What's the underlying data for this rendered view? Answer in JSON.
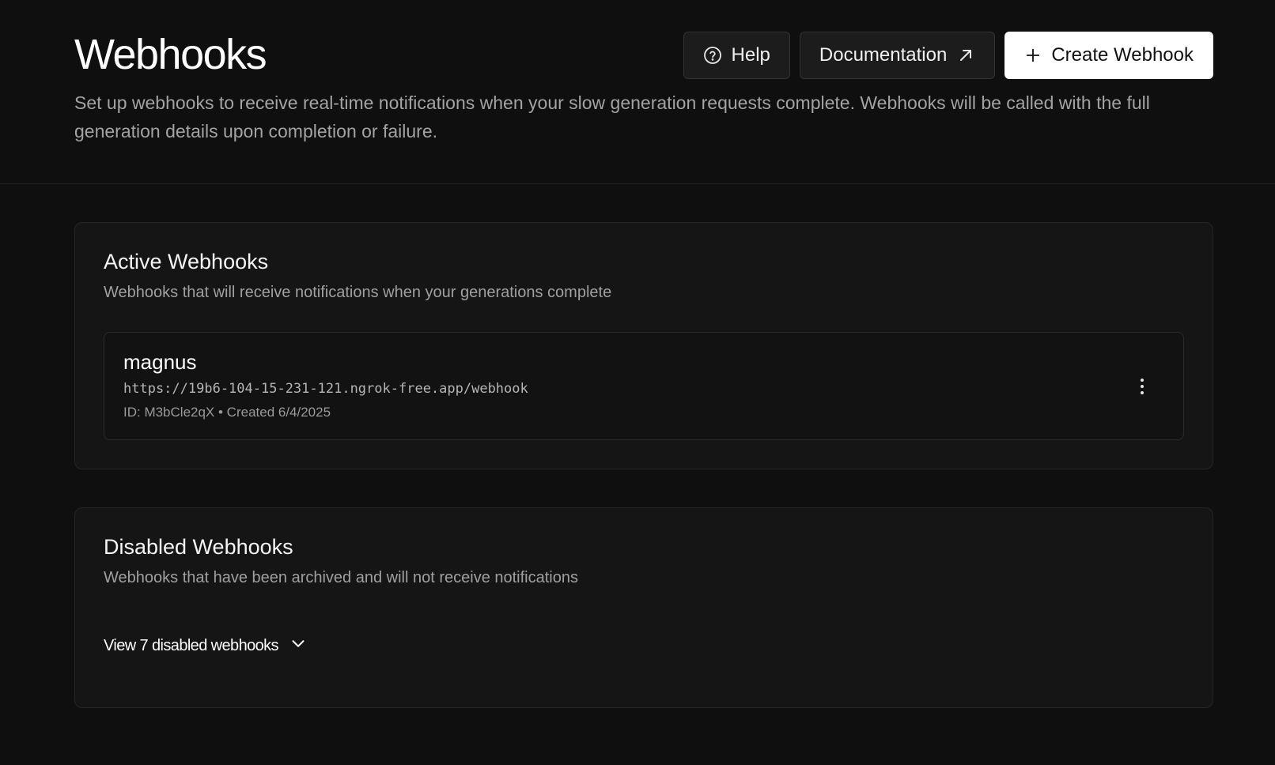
{
  "header": {
    "title": "Webhooks",
    "description": "Set up webhooks to receive real-time notifications when your slow generation requests complete. Webhooks will be called with the full generation details upon completion or failure.",
    "help_label": "Help",
    "docs_label": "Documentation",
    "create_label": "Create Webhook"
  },
  "active": {
    "title": "Active Webhooks",
    "description": "Webhooks that will receive notifications when your generations complete",
    "items": [
      {
        "name": "magnus",
        "url": "https://19b6-104-15-231-121.ngrok-free.app/webhook",
        "meta": "ID: M3bCle2qX • Created 6/4/2025"
      }
    ]
  },
  "disabled": {
    "title": "Disabled Webhooks",
    "description": "Webhooks that have been archived and will not receive notifications",
    "toggle_label": "View 7 disabled webhooks"
  },
  "icons": {
    "help": "help-circle-icon",
    "docs": "arrow-up-right-icon",
    "create": "plus-icon",
    "menu": "more-vertical-icon",
    "expand": "chevron-down-icon"
  },
  "colors": {
    "background": "#0f0f0f",
    "card": "#151515",
    "primary_button": "#ffffff"
  }
}
